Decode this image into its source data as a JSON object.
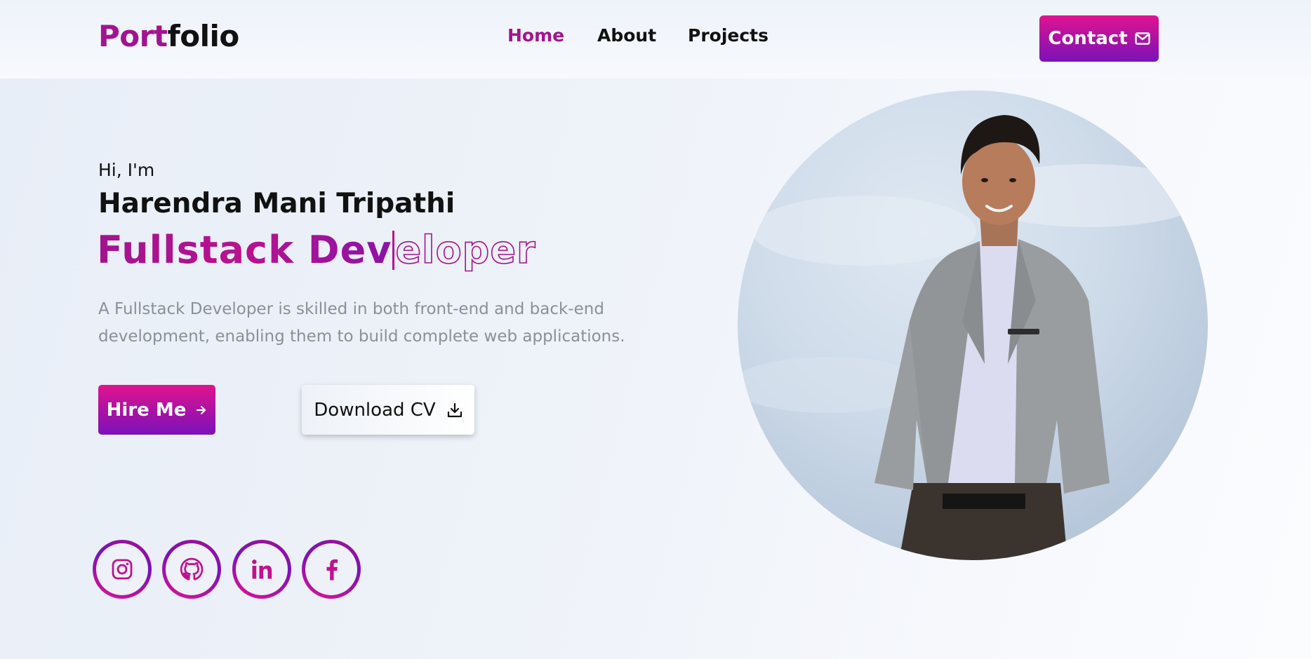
{
  "header": {
    "logo": {
      "part1": "Port",
      "part2": "folio"
    },
    "nav": [
      {
        "label": "Home",
        "active": true
      },
      {
        "label": "About",
        "active": false
      },
      {
        "label": "Projects",
        "active": false
      }
    ],
    "contact_label": "Contact",
    "contact_icon": "mail-icon"
  },
  "hero": {
    "greeting": "Hi, I'm",
    "name": "Harendra Mani Tripathi",
    "role_typed": "Fullstack Dev",
    "role_rest": "eloper",
    "description": "A Fullstack Developer is skilled in both front-end and back-end development, enabling them to build complete web applications.",
    "hire_label": "Hire Me",
    "hire_icon": "arrow-right-icon",
    "cv_label": "Download CV",
    "cv_icon": "download-icon"
  },
  "socials": [
    {
      "name": "instagram",
      "icon": "instagram-icon"
    },
    {
      "name": "github",
      "icon": "github-icon"
    },
    {
      "name": "linkedin",
      "icon": "linkedin-icon"
    },
    {
      "name": "facebook",
      "icon": "facebook-icon"
    }
  ],
  "colors": {
    "accent": "#a3138f",
    "gradient_start": "#e0138f",
    "gradient_end": "#7a12b8",
    "text": "#111111",
    "muted": "#8a8f99"
  }
}
